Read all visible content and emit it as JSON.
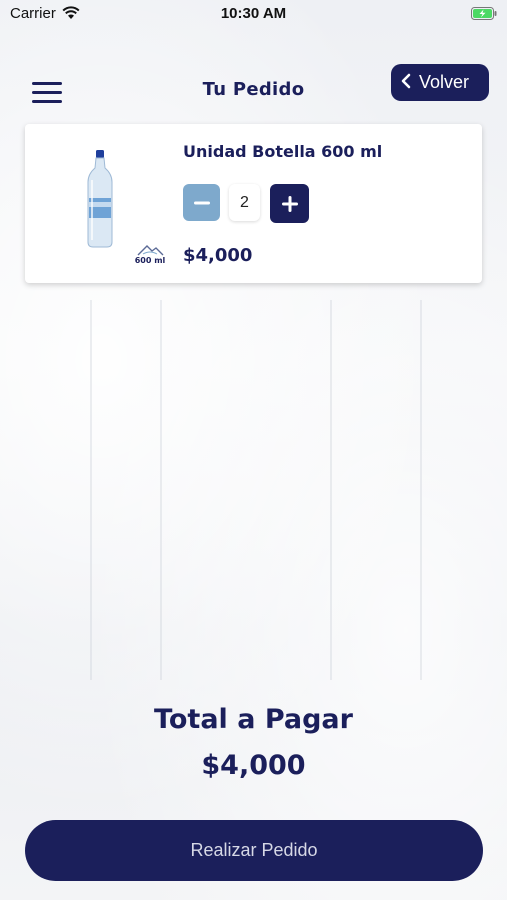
{
  "status_bar": {
    "carrier": "Carrier",
    "time": "10:30 AM",
    "icons": [
      "wifi-icon",
      "battery-charging-icon"
    ]
  },
  "header": {
    "title": "Tu Pedido",
    "back_label": "Volver",
    "menu_icon": "hamburger-menu-icon",
    "back_icon": "chevron-left-icon"
  },
  "cart": {
    "items": [
      {
        "name": "Unidad Botella 600 ml",
        "quantity": "2",
        "price": "$4,000",
        "badge": "600 ml",
        "image_icon": "water-bottle-icon"
      }
    ]
  },
  "summary": {
    "total_label": "Total a Pagar",
    "total_value": "$4,000"
  },
  "actions": {
    "order_label": "Realizar Pedido"
  },
  "colors": {
    "brand": "#1b1f5b",
    "minus_button": "#7ea9cc",
    "battery": "#4cd964"
  }
}
